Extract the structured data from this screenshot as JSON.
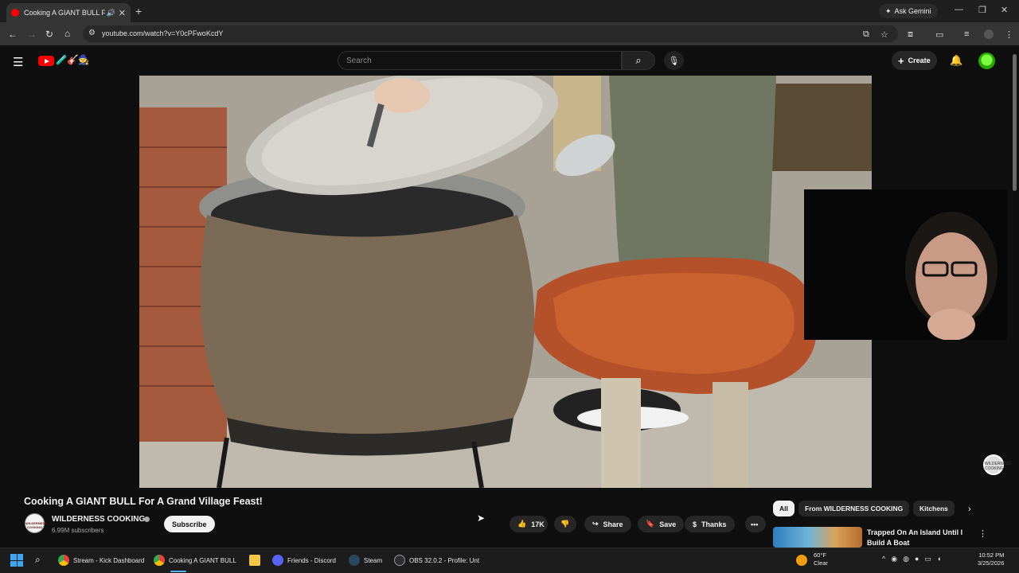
{
  "browser": {
    "tab_title": "Cooking A GIANT BULL For",
    "new_tab": "+",
    "ask_gemini": "Ask Gemini",
    "url": "youtube.com/watch?v=Y0cPFwoKcdY",
    "window_controls": [
      "—",
      "❐",
      "✕"
    ]
  },
  "youtube": {
    "search_placeholder": "Search",
    "create_label": "Create",
    "video": {
      "title": "Cooking A GIANT BULL For A Grand Village Feast!",
      "channel": "WILDERNESS COOKING",
      "subscribers": "6.99M subscribers",
      "subscribe_label": "Subscribe",
      "likes": "17K",
      "share_label": "Share",
      "save_label": "Save",
      "thanks_label": "Thanks",
      "watermark_text": "WILDERNESS COOKING"
    },
    "chips": [
      "All",
      "From WILDERNESS COOKING",
      "Kitchens"
    ],
    "recommendation": {
      "title": "Trapped On An Island Until I Build A Boat"
    }
  },
  "taskbar": {
    "items": [
      {
        "label": "Stream - Kick Dashboard",
        "color": "#34a853"
      },
      {
        "label": "Cooking A GIANT BULL",
        "color": "#ea4335"
      },
      {
        "label": "",
        "color": "#f4c542"
      },
      {
        "label": "Friends - Discord",
        "color": "#5865f2"
      },
      {
        "label": "Steam",
        "color": "#1b2838"
      },
      {
        "label": "OBS 32.0.2 - Profile: Unt",
        "color": "#302e31"
      }
    ],
    "weather_temp": "60°F",
    "weather_desc": "Clear",
    "time": "10:52 PM",
    "date": "3/25/2026"
  },
  "colors": {
    "youtube_red": "#ff0000",
    "background": "#0f0f0f",
    "accent_blue": "#5ab0f5"
  }
}
